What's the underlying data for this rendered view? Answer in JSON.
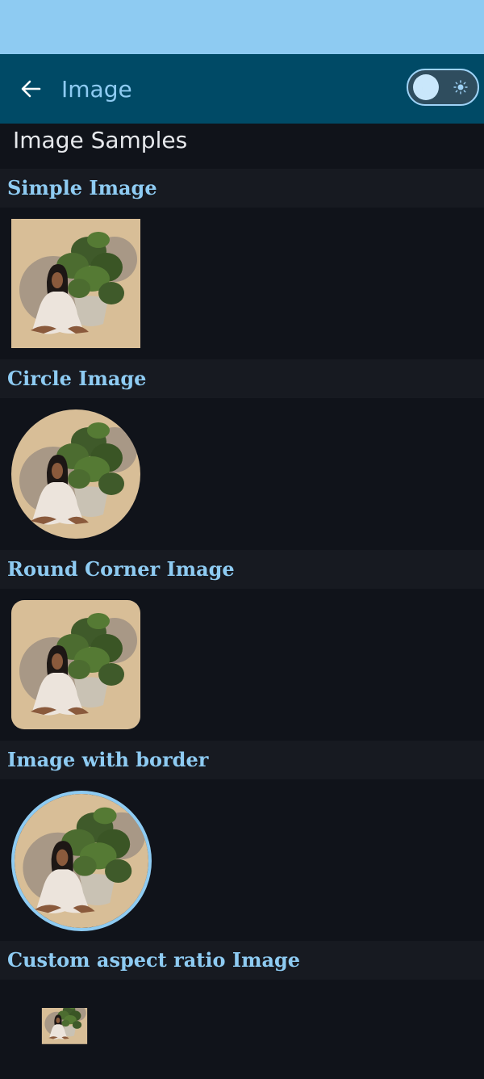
{
  "app": {
    "title": "Image",
    "back_icon": "arrow-left-icon",
    "theme_toggle": {
      "state": "dark",
      "dark_icon": "moon-icon",
      "light_icon": "sun-icon"
    }
  },
  "page": {
    "heading": "Image Samples"
  },
  "sections": [
    {
      "title": "Simple Image",
      "style": "square"
    },
    {
      "title": "Circle Image",
      "style": "circle"
    },
    {
      "title": "Round Corner Image",
      "style": "rounded"
    },
    {
      "title": "Image with border",
      "style": "circle-with-border"
    },
    {
      "title": "Custom aspect ratio Image",
      "style": "custom-aspect-ratio"
    }
  ],
  "colors": {
    "status_bar": "#8ecbf2",
    "app_bar": "#004a66",
    "background": "#10131a",
    "section_header_bg": "#171a21",
    "accent_text": "#8ecbf2",
    "image_border": "#8ecbf2"
  }
}
